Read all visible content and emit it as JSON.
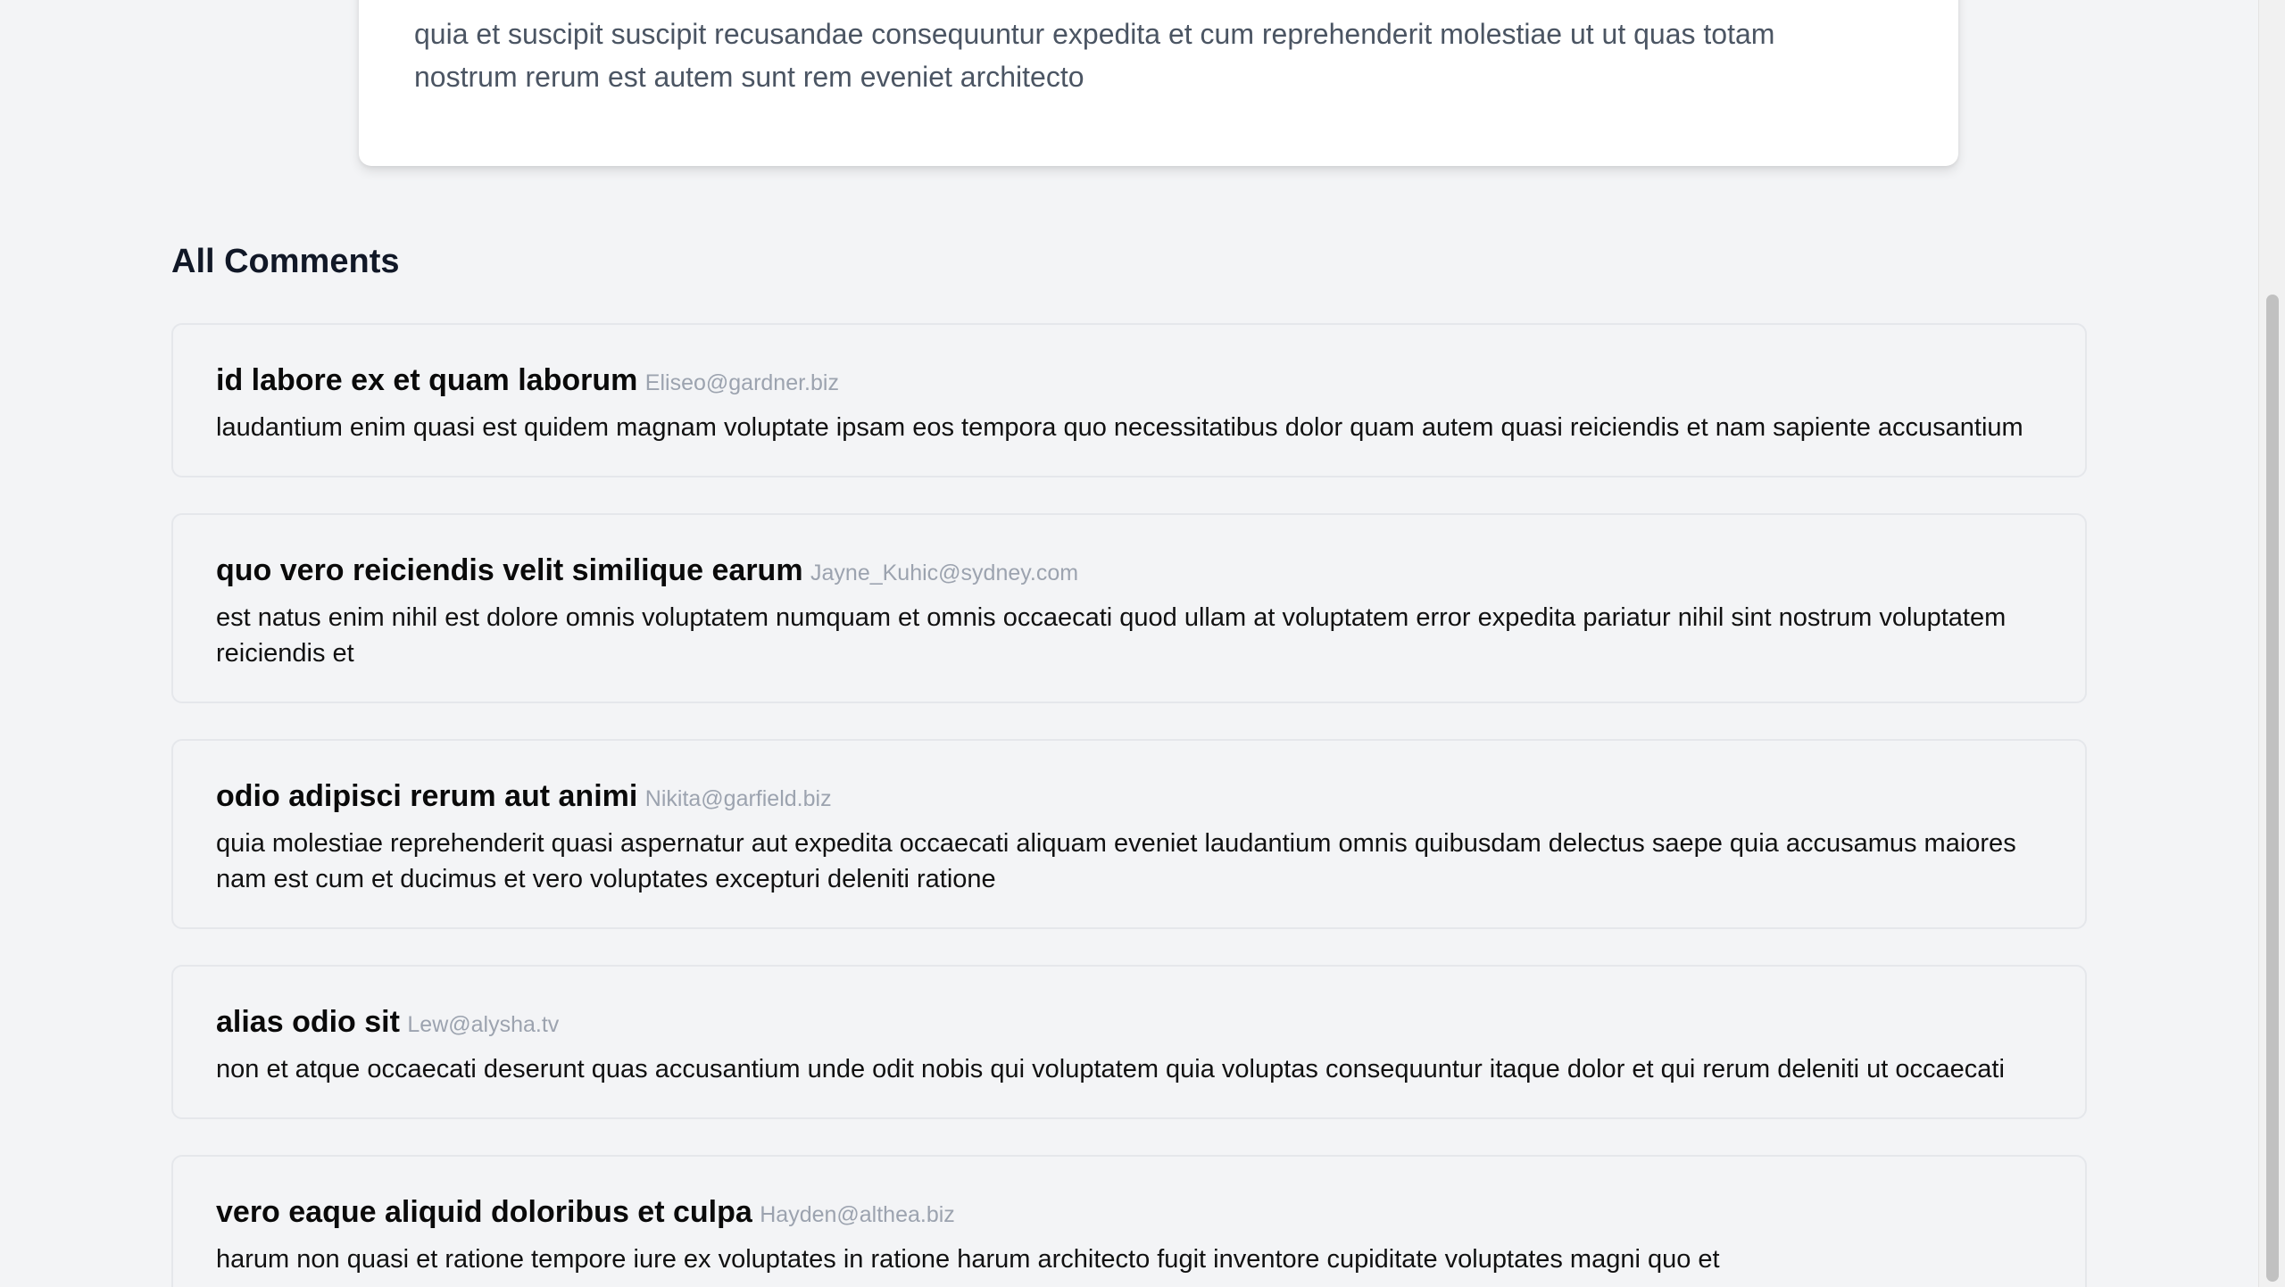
{
  "post": {
    "body_line1": "quia et suscipit suscipit recusandae consequuntur expedita et cum reprehenderit molestiae ut ut quas totam",
    "body_line2": "nostrum rerum est autem sunt rem eveniet architecto"
  },
  "comments_section": {
    "title": "All Comments",
    "comments": [
      {
        "name": "id labore ex et quam laborum",
        "email": "Eliseo@gardner.biz",
        "body": "laudantium enim quasi est quidem magnam voluptate ipsam eos tempora quo necessitatibus dolor quam autem quasi reiciendis et nam sapiente accusantium"
      },
      {
        "name": "quo vero reiciendis velit similique earum",
        "email": "Jayne_Kuhic@sydney.com",
        "body": "est natus enim nihil est dolore omnis voluptatem numquam et omnis occaecati quod ullam at voluptatem error expedita pariatur nihil sint nostrum voluptatem reiciendis et"
      },
      {
        "name": "odio adipisci rerum aut animi",
        "email": "Nikita@garfield.biz",
        "body": "quia molestiae reprehenderit quasi aspernatur aut expedita occaecati aliquam eveniet laudantium omnis quibusdam delectus saepe quia accusamus maiores nam est cum et ducimus et vero voluptates excepturi deleniti ratione"
      },
      {
        "name": "alias odio sit",
        "email": "Lew@alysha.tv",
        "body": "non et atque occaecati deserunt quas accusantium unde odit nobis qui voluptatem quia voluptas consequuntur itaque dolor et qui rerum deleniti ut occaecati"
      },
      {
        "name": "vero eaque aliquid doloribus et culpa",
        "email": "Hayden@althea.biz",
        "body": "harum non quasi et ratione tempore iure ex voluptates in ratione harum architecto fugit inventore cupiditate voluptates magni quo et"
      }
    ]
  }
}
